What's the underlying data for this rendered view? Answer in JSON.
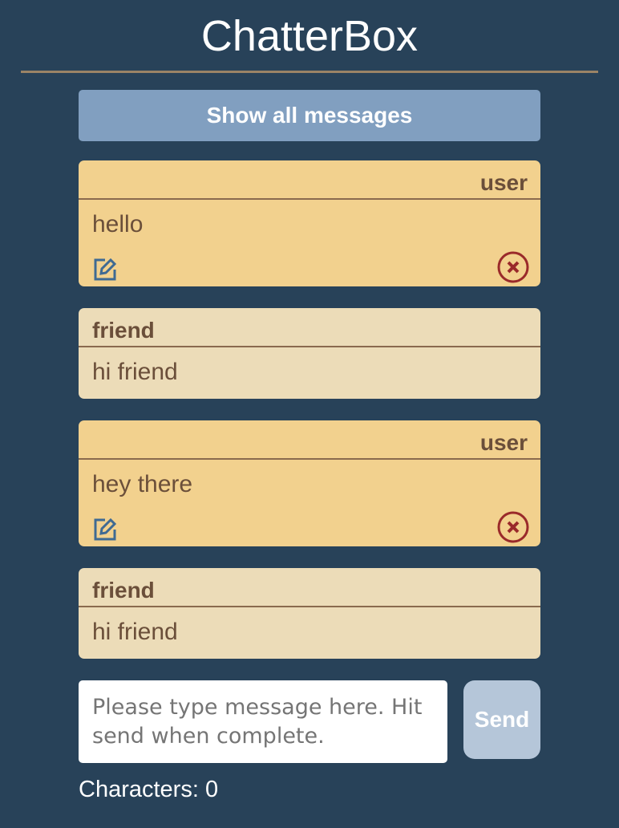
{
  "app": {
    "title": "ChatterBox"
  },
  "show_all_label": "Show all messages",
  "messages": [
    {
      "sender": "user",
      "text": "hello",
      "own": true
    },
    {
      "sender": "friend",
      "text": "hi friend",
      "own": false
    },
    {
      "sender": "user",
      "text": "hey there",
      "own": true
    },
    {
      "sender": "friend",
      "text": "hi friend",
      "own": false
    }
  ],
  "composer": {
    "placeholder": "Please type message here. Hit send when complete.",
    "value": "",
    "send_label": "Send",
    "char_count_label": "Characters: 0"
  },
  "colors": {
    "background": "#284259",
    "user_card": "#f2d18e",
    "friend_card": "#ecdcb8",
    "accent": "#819fc0",
    "edit_icon": "#3f6a93",
    "delete_icon": "#9a2a2a"
  }
}
